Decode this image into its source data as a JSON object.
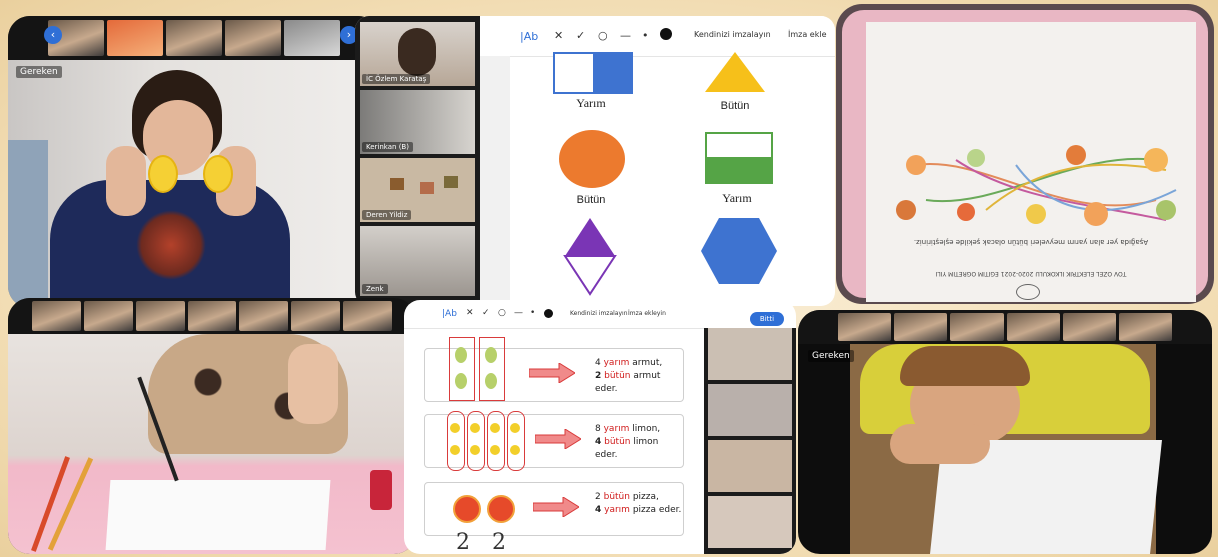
{
  "tile1": {
    "self_label": "Gereken"
  },
  "tile2": {
    "participants": [
      "İC Özlem Karataş",
      "Kerinkan (B)",
      "Deren Yildiz",
      "Zenk"
    ],
    "toolbar": {
      "draw": "Kendinizi imzalayın",
      "sign": "İmza ekle"
    },
    "shape_labels": [
      "Yarım",
      "Bütün",
      "Bütün",
      "Yarım"
    ]
  },
  "tile3": {
    "paper_title": "Aşağıda yer alan yarım meyveleri bütün olacak şekilde eşleştiriniz.",
    "header": "TOV ÖZEL ELEKTRİK İLKOKULU 2020-2021 EĞİTİM ÖĞRETİM YILI"
  },
  "tile5": {
    "toolbar": {
      "draw": "Kendinizi imzalayın",
      "sign": "İmza ekleyin",
      "done": "Bitti"
    },
    "rows": [
      {
        "line1_num": "4",
        "line1_word": "yarım",
        "line1_rest": "armut,",
        "line2_num": "2",
        "line2_word": "bütün",
        "line2_rest": "armut eder."
      },
      {
        "line1_num": "8",
        "line1_word": "yarım",
        "line1_rest": "limon,",
        "line2_num": "4",
        "line2_word": "bütün",
        "line2_rest": "limon eder."
      },
      {
        "line1_num": "2",
        "line1_word": "bütün",
        "line1_rest": "pizza,",
        "line2_num": "4",
        "line2_word": "yarım",
        "line2_rest": "pizza eder."
      }
    ],
    "bottom_written": [
      "2",
      "2"
    ]
  },
  "tile6": {
    "self_label": "Gereken"
  },
  "colors": {
    "accent_blue": "#2f6fd6",
    "bg": "#f4e2bd",
    "shape_blue": "#3e73d0",
    "shape_orange": "#ec7a2e",
    "shape_yellow": "#f6c01a",
    "shape_green": "#55a446",
    "shape_purple": "#7a35b5"
  }
}
